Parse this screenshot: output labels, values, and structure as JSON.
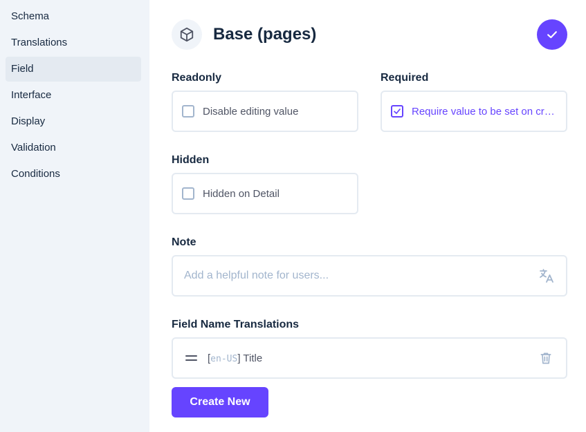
{
  "sidebar": {
    "items": [
      {
        "label": "Schema",
        "active": false
      },
      {
        "label": "Translations",
        "active": false
      },
      {
        "label": "Field",
        "active": true
      },
      {
        "label": "Interface",
        "active": false
      },
      {
        "label": "Display",
        "active": false
      },
      {
        "label": "Validation",
        "active": false
      },
      {
        "label": "Conditions",
        "active": false
      }
    ]
  },
  "header": {
    "icon": "cube-icon",
    "title": "Base (pages)",
    "save_icon": "check-icon"
  },
  "fields": {
    "readonly": {
      "label": "Readonly",
      "option": "Disable editing value",
      "checked": false
    },
    "required": {
      "label": "Required",
      "option": "Require value to be set on cre...",
      "checked": true
    },
    "hidden": {
      "label": "Hidden",
      "option": "Hidden on Detail",
      "checked": false
    },
    "note": {
      "label": "Note",
      "value": "",
      "placeholder": "Add a helpful note for users...",
      "icon": "translate-icon"
    },
    "translations": {
      "label": "Field Name Translations",
      "items": [
        {
          "open_bracket": "[",
          "lang": "en-US",
          "close_bracket": "]",
          "text": "Title"
        }
      ],
      "create_label": "Create New"
    }
  },
  "colors": {
    "accent": "#6644ff",
    "sidebar_bg": "#f0f4f9",
    "border": "#e4eaf1",
    "text": "#172940",
    "muted": "#a2b5cd"
  }
}
